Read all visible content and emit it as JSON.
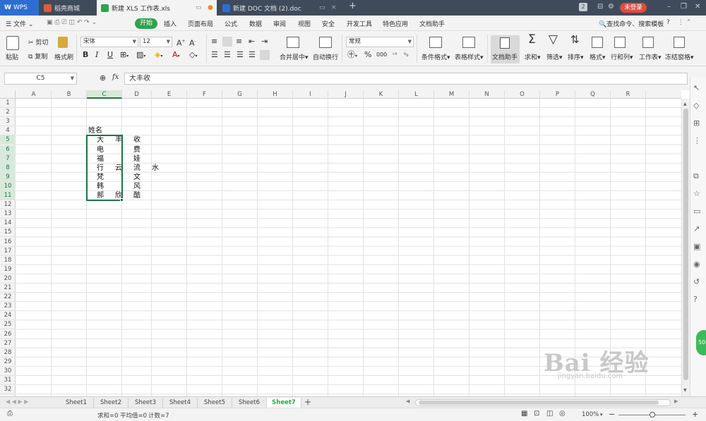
{
  "titlebar": {
    "tabs": [
      {
        "label": "WPS",
        "active": false,
        "icon": "wps-logo-icon"
      },
      {
        "label": "稻壳商城",
        "active": false,
        "icon": "docer-icon"
      },
      {
        "label": "新建 XLS 工作表.xls",
        "active": true,
        "icon": "sheet-icon"
      },
      {
        "label": "新建 DOC 文档 (2).doc",
        "active": false,
        "icon": "writer-icon"
      }
    ],
    "new_tab": "+",
    "badge": "2",
    "login_label": "未登录"
  },
  "menubar": {
    "file_label": "文件",
    "items": [
      "开始",
      "插入",
      "页面布局",
      "公式",
      "数据",
      "审阅",
      "视图",
      "安全",
      "开发工具",
      "特色应用",
      "文档助手"
    ],
    "search_label": "查找命令、搜索模板",
    "help": "?"
  },
  "ribbon": {
    "paste": "粘贴",
    "cut": "剪切",
    "copy": "复制",
    "format_painter": "格式刷",
    "font_name": "宋体",
    "font_size": "12",
    "merge_center": "合并居中",
    "wrap_text": "自动换行",
    "number_format": "常规",
    "conditional_format": "条件格式",
    "table_style": "表格样式",
    "doc_helper": "文档助手",
    "sum": "求和",
    "filter": "筛选",
    "sort": "排序",
    "format": "格式",
    "row_col": "行和列",
    "worksheet": "工作表",
    "freeze": "冻结窗格"
  },
  "formula_bar": {
    "cell_ref": "C5",
    "fx": "fx",
    "content": "大丰收"
  },
  "columns": [
    "A",
    "B",
    "C",
    "D",
    "E",
    "F",
    "G",
    "H",
    "I",
    "J",
    "K",
    "L",
    "M",
    "N",
    "O",
    "P",
    "Q",
    "R"
  ],
  "rows": [
    "1",
    "2",
    "3",
    "4",
    "5",
    "6",
    "7",
    "8",
    "9",
    "10",
    "11",
    "12",
    "13",
    "14",
    "15",
    "16",
    "17",
    "18",
    "19",
    "20",
    "21",
    "22",
    "23",
    "24",
    "25",
    "26",
    "27",
    "28",
    "29",
    "30",
    "31",
    "32"
  ],
  "cells": {
    "c4": "姓名",
    "names": [
      [
        "大",
        "丰",
        "收"
      ],
      [
        "电",
        "",
        "费"
      ],
      [
        "福",
        "",
        "娃"
      ],
      [
        "行",
        "云",
        "流",
        "水"
      ],
      [
        "梵",
        "",
        "文"
      ],
      [
        "韩",
        "",
        "风"
      ],
      [
        "郝",
        "欣",
        "酷"
      ]
    ]
  },
  "sheets": [
    "Sheet1",
    "Sheet2",
    "Sheet3",
    "Sheet4",
    "Sheet5",
    "Sheet6",
    "Sheet7"
  ],
  "active_sheet": "Sheet7",
  "add_sheet": "+",
  "status": {
    "sum": "求和=0",
    "avg": "平均值=0",
    "count": "计数=7",
    "zoom": "100%"
  },
  "floating_badge": "50",
  "watermark": {
    "text": "Bai 经验",
    "url": "jingyan.baidu.com"
  },
  "colors": {
    "accent": "#2ea44f",
    "selection": "#217346",
    "titlebar": "#3f4b5b",
    "login": "#e04b3c"
  }
}
